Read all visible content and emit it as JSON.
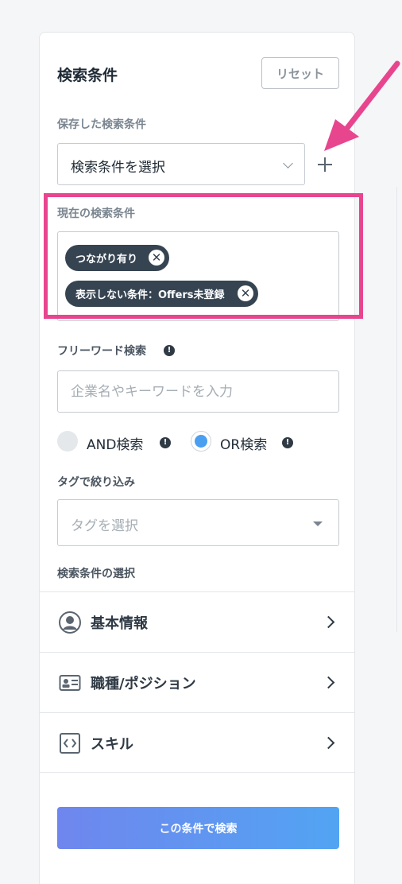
{
  "panel": {
    "heading": "検索条件",
    "reset_label": "リセット",
    "saved_label": "保存した検索条件",
    "saved_select_value": "検索条件を選択",
    "current_label": "現在の検索条件",
    "chips": [
      {
        "label": "つながり有り"
      },
      {
        "label": "表示しない条件：Offers未登録"
      }
    ],
    "freeword_label": "フリーワード検索",
    "freeword_placeholder": "企業名やキーワードを入力",
    "radio_and_label": "AND検索",
    "radio_or_label": "OR検索",
    "radio_selected": "OR",
    "tag_label": "タグで絞り込み",
    "tag_placeholder": "タグを選択",
    "criteria_label": "検索条件の選択",
    "categories": [
      {
        "label": "基本情報",
        "icon": "user-circle-icon"
      },
      {
        "label": "職種/ポジション",
        "icon": "id-card-icon"
      },
      {
        "label": "スキル",
        "icon": "code-icon"
      }
    ],
    "search_button": "この条件で検索"
  },
  "annotation": {
    "highlight_color": "#e8458f",
    "arrow_color": "#e8458f"
  },
  "accent_color": "#4a9ff0"
}
